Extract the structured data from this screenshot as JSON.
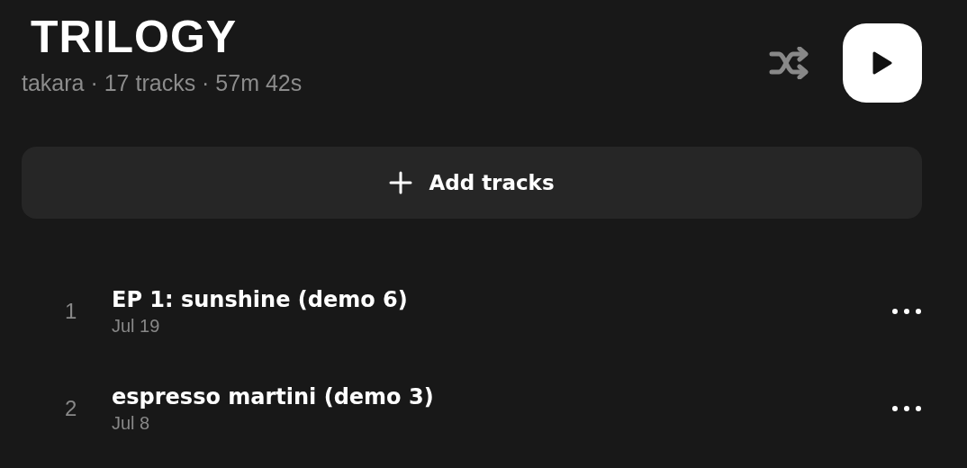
{
  "playlist": {
    "title": "TRILOGY",
    "meta": "takara · 17 tracks · 57m 42s"
  },
  "add_button": {
    "label": "Add tracks"
  },
  "tracks": [
    {
      "number": "1",
      "title": "EP 1: sunshine (demo 6)",
      "date": "Jul 19"
    },
    {
      "number": "2",
      "title": "espresso martini (demo 3)",
      "date": "Jul 8"
    }
  ]
}
